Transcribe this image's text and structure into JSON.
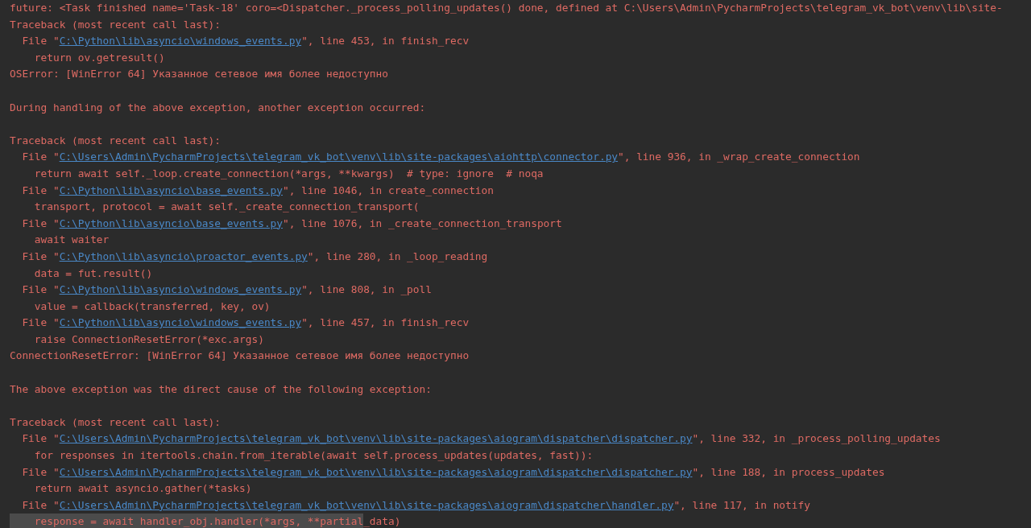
{
  "console": {
    "lines": [
      {
        "kind": "text",
        "text": "future: <Task finished name='Task-18' coro=<Dispatcher._process_polling_updates() done, defined at C:\\Users\\Admin\\PycharmProjects\\telegram_vk_bot\\venv\\lib\\site-"
      },
      {
        "kind": "text",
        "text": "Traceback (most recent call last):"
      },
      {
        "kind": "file",
        "prefix": "File \"",
        "path": "C:\\Python\\lib\\asyncio\\windows_events.py",
        "location": "\", line 453, in finish_recv"
      },
      {
        "kind": "code",
        "text": "return ov.getresult()"
      },
      {
        "kind": "text",
        "text": "OSError: [WinError 64] Указанное сетевое имя более недоступно"
      },
      {
        "kind": "blank"
      },
      {
        "kind": "text",
        "text": "During handling of the above exception, another exception occurred:"
      },
      {
        "kind": "blank"
      },
      {
        "kind": "text",
        "text": "Traceback (most recent call last):"
      },
      {
        "kind": "file",
        "prefix": "File \"",
        "path": "C:\\Users\\Admin\\PycharmProjects\\telegram_vk_bot\\venv\\lib\\site-packages\\aiohttp\\connector.py",
        "location": "\", line 936, in _wrap_create_connection"
      },
      {
        "kind": "code",
        "text": "return await self._loop.create_connection(*args, **kwargs)  # type: ignore  # noqa"
      },
      {
        "kind": "file",
        "prefix": "File \"",
        "path": "C:\\Python\\lib\\asyncio\\base_events.py",
        "location": "\", line 1046, in create_connection"
      },
      {
        "kind": "code",
        "text": "transport, protocol = await self._create_connection_transport("
      },
      {
        "kind": "file",
        "prefix": "File \"",
        "path": "C:\\Python\\lib\\asyncio\\base_events.py",
        "location": "\", line 1076, in _create_connection_transport"
      },
      {
        "kind": "code",
        "text": "await waiter"
      },
      {
        "kind": "file",
        "prefix": "File \"",
        "path": "C:\\Python\\lib\\asyncio\\proactor_events.py",
        "location": "\", line 280, in _loop_reading"
      },
      {
        "kind": "code",
        "text": "data = fut.result()"
      },
      {
        "kind": "file",
        "prefix": "File \"",
        "path": "C:\\Python\\lib\\asyncio\\windows_events.py",
        "location": "\", line 808, in _poll"
      },
      {
        "kind": "code",
        "text": "value = callback(transferred, key, ov)"
      },
      {
        "kind": "file",
        "prefix": "File \"",
        "path": "C:\\Python\\lib\\asyncio\\windows_events.py",
        "location": "\", line 457, in finish_recv"
      },
      {
        "kind": "code",
        "text": "raise ConnectionResetError(*exc.args)"
      },
      {
        "kind": "text",
        "text": "ConnectionResetError: [WinError 64] Указанное сетевое имя более недоступно"
      },
      {
        "kind": "blank"
      },
      {
        "kind": "text",
        "text": "The above exception was the direct cause of the following exception:"
      },
      {
        "kind": "blank"
      },
      {
        "kind": "text",
        "text": "Traceback (most recent call last):"
      },
      {
        "kind": "file",
        "prefix": "File \"",
        "path": "C:\\Users\\Admin\\PycharmProjects\\telegram_vk_bot\\venv\\lib\\site-packages\\aiogram\\dispatcher\\dispatcher.py",
        "location": "\", line 332, in _process_polling_updates"
      },
      {
        "kind": "code",
        "text": "for responses in itertools.chain.from_iterable(await self.process_updates(updates, fast)):"
      },
      {
        "kind": "file",
        "prefix": "File \"",
        "path": "C:\\Users\\Admin\\PycharmProjects\\telegram_vk_bot\\venv\\lib\\site-packages\\aiogram\\dispatcher\\dispatcher.py",
        "location": "\", line 188, in process_updates"
      },
      {
        "kind": "code",
        "text": "return await asyncio.gather(*tasks)"
      },
      {
        "kind": "file",
        "prefix": "File \"",
        "path": "C:\\Users\\Admin\\PycharmProjects\\telegram_vk_bot\\venv\\lib\\site-packages\\aiogram\\dispatcher\\handler.py",
        "location": "\", line 117, in notify"
      },
      {
        "kind": "code",
        "parts": [
          {
            "text": "response = await handler_obj.handler(*args, **partial",
            "selected": true
          },
          {
            "text": "_data)",
            "selected": false
          }
        ]
      }
    ]
  }
}
